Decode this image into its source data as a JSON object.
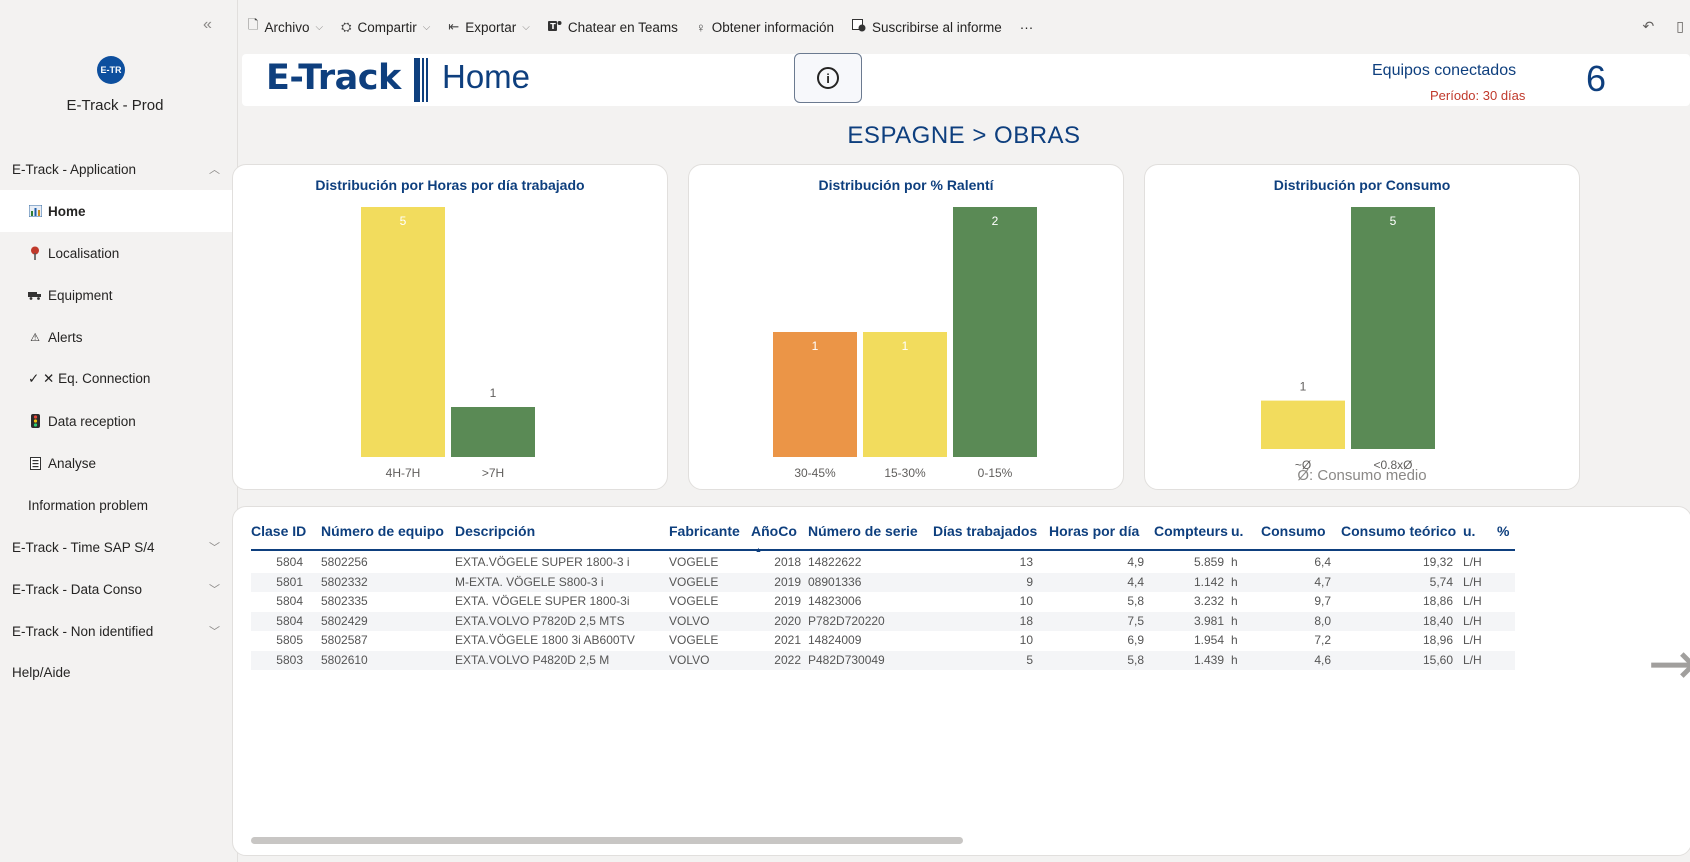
{
  "sidebar": {
    "collapse_glyph": "«",
    "workspace_logo_text": "E-TR",
    "workspace_name": "E-Track - Prod",
    "sections": [
      {
        "label": "E-Track - Application",
        "expanded": true
      },
      {
        "label": "E-Track - Time SAP S/4",
        "expanded": false
      },
      {
        "label": "E-Track - Data Conso",
        "expanded": false
      },
      {
        "label": "E-Track - Non identified",
        "expanded": false
      }
    ],
    "items": [
      {
        "label": "Home",
        "icon": "bar-chart-icon",
        "active": true
      },
      {
        "label": "Localisation",
        "icon": "map-pin-icon"
      },
      {
        "label": "Equipment",
        "icon": "truck-icon"
      },
      {
        "label": "Alerts",
        "icon": "warning-icon"
      },
      {
        "label": "✓ ✕ Eq. Connection",
        "icon": ""
      },
      {
        "label": "Data reception",
        "icon": "traffic-light-icon"
      },
      {
        "label": "Analyse",
        "icon": "document-icon"
      },
      {
        "label": "Information problem",
        "icon": ""
      }
    ],
    "help_label": "Help/Aide"
  },
  "toolbar": {
    "archivo": "Archivo",
    "compartir": "Compartir",
    "exportar": "Exportar",
    "chatear": "Chatear en Teams",
    "obtener": "Obtener información",
    "suscribirse": "Suscribirse al informe",
    "more": "···"
  },
  "header": {
    "brand": "E-Track",
    "title": "Home",
    "kpi_label": "Equipos conectados",
    "kpi_period": "Período: 30 días",
    "kpi_value": "6"
  },
  "breadcrumb": "ESPAGNE > OBRAS",
  "chart_data": [
    {
      "type": "bar",
      "title": "Distribución por Horas por día trabajado",
      "categories": [
        "4H-7H",
        ">7H"
      ],
      "values": [
        5,
        1
      ],
      "colors": [
        "#f2dc5d",
        "#5a8a55"
      ],
      "ylim": [
        0,
        5
      ],
      "xlabel": "",
      "ylabel": ""
    },
    {
      "type": "bar",
      "title": "Distribución por % Ralentí",
      "categories": [
        "30-45%",
        "15-30%",
        "0-15%"
      ],
      "values": [
        1,
        1,
        2
      ],
      "colors": [
        "#eb9547",
        "#f2dc5d",
        "#5a8a55"
      ],
      "ylim": [
        0,
        2
      ],
      "xlabel": "",
      "ylabel": ""
    },
    {
      "type": "bar",
      "title": "Distribución por Consumo",
      "categories": [
        "~Ø",
        "<0.8xØ"
      ],
      "values": [
        1,
        5
      ],
      "colors": [
        "#f2dc5d",
        "#5a8a55"
      ],
      "ylim": [
        0,
        5
      ],
      "xlabel": "",
      "ylabel": "",
      "footnote": "Ø: Consumo medio"
    }
  ],
  "table": {
    "columns": [
      "Clase ID",
      "Número de equipo",
      "Descripción",
      "Fabricante",
      "AñoCo",
      "Número de serie",
      "Días trabajados",
      "Horas por día",
      "Compteurs",
      "u.",
      "Consumo",
      "Consumo teórico",
      "u.",
      "% "
    ],
    "rows": [
      [
        "5804",
        "5802256",
        "EXTA.VÖGELE SUPER 1800-3 i",
        "VOGELE",
        "2018",
        "14822622",
        "13",
        "4,9",
        "5.859",
        "h",
        "6,4",
        "19,32",
        "L/H"
      ],
      [
        "5801",
        "5802332",
        "M-EXTA. VÖGELE S800-3 i",
        "VOGELE",
        "2019",
        "08901336",
        "9",
        "4,4",
        "1.142",
        "h",
        "4,7",
        "5,74",
        "L/H"
      ],
      [
        "5804",
        "5802335",
        "EXTA. VÖGELE SUPER 1800-3i",
        "VOGELE",
        "2019",
        "14823006",
        "10",
        "5,8",
        "3.232",
        "h",
        "9,7",
        "18,86",
        "L/H"
      ],
      [
        "5804",
        "5802429",
        "EXTA.VOLVO P7820D 2,5 MTS",
        "VOLVO",
        "2020",
        "P782D720220",
        "18",
        "7,5",
        "3.981",
        "h",
        "8,0",
        "18,40",
        "L/H"
      ],
      [
        "5805",
        "5802587",
        "EXTA.VÖGELE 1800 3i AB600TV",
        "VOGELE",
        "2021",
        "14824009",
        "10",
        "6,9",
        "1.954",
        "h",
        "7,2",
        "18,96",
        "L/H"
      ],
      [
        "5803",
        "5802610",
        "EXTA.VOLVO P4820D 2,5 M",
        "VOLVO",
        "2022",
        "P482D730049",
        "5",
        "5,8",
        "1.439",
        "h",
        "4,6",
        "15,60",
        "L/H"
      ]
    ]
  },
  "colors": {
    "brand": "#0e3f7e",
    "period": "#c0392b",
    "yellow": "#f2dc5d",
    "green": "#5a8a55",
    "orange": "#eb9547"
  }
}
